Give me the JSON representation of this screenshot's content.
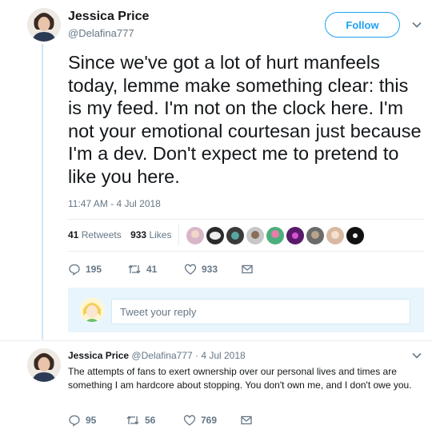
{
  "tweet": {
    "author_name": "Jessica Price",
    "author_handle": "@Delafina777",
    "follow_label": "Follow",
    "text": "Since we've got a lot of hurt manfeels today, lemme make something clear: this is my feed. I'm not on the clock here. I'm not your emotional courtesan just because I'm a dev. Don't expect me to pretend to like you here.",
    "timestamp": "11:47 AM - 4 Jul 2018",
    "retweets_count": "41",
    "retweets_label": "Retweets",
    "likes_count": "933",
    "likes_label": "Likes",
    "actions": {
      "replies": "195",
      "retweets": "41",
      "likes": "933"
    }
  },
  "liker_colors": [
    "#d9b6c7",
    "#2b2b2b",
    "#3a3a3a",
    "#c7c7c7",
    "#4caf7d",
    "#5a1a6b",
    "#6b6b6b",
    "#d8b8a0",
    "#111111"
  ],
  "reply_box": {
    "placeholder": "Tweet your reply"
  },
  "reply": {
    "author_name": "Jessica Price",
    "author_handle": "@Delafina777",
    "date": "· 4 Jul 2018",
    "text": "The attempts of fans to exert ownership over our personal lives and times are something I am hardcore about stopping. You don't own me, and I don't owe you.",
    "actions": {
      "replies": "95",
      "retweets": "56",
      "likes": "769"
    }
  },
  "colors": {
    "accent": "#1da1f2",
    "muted": "#657786",
    "text": "#14171a",
    "thread_line": "#cce6f5"
  }
}
